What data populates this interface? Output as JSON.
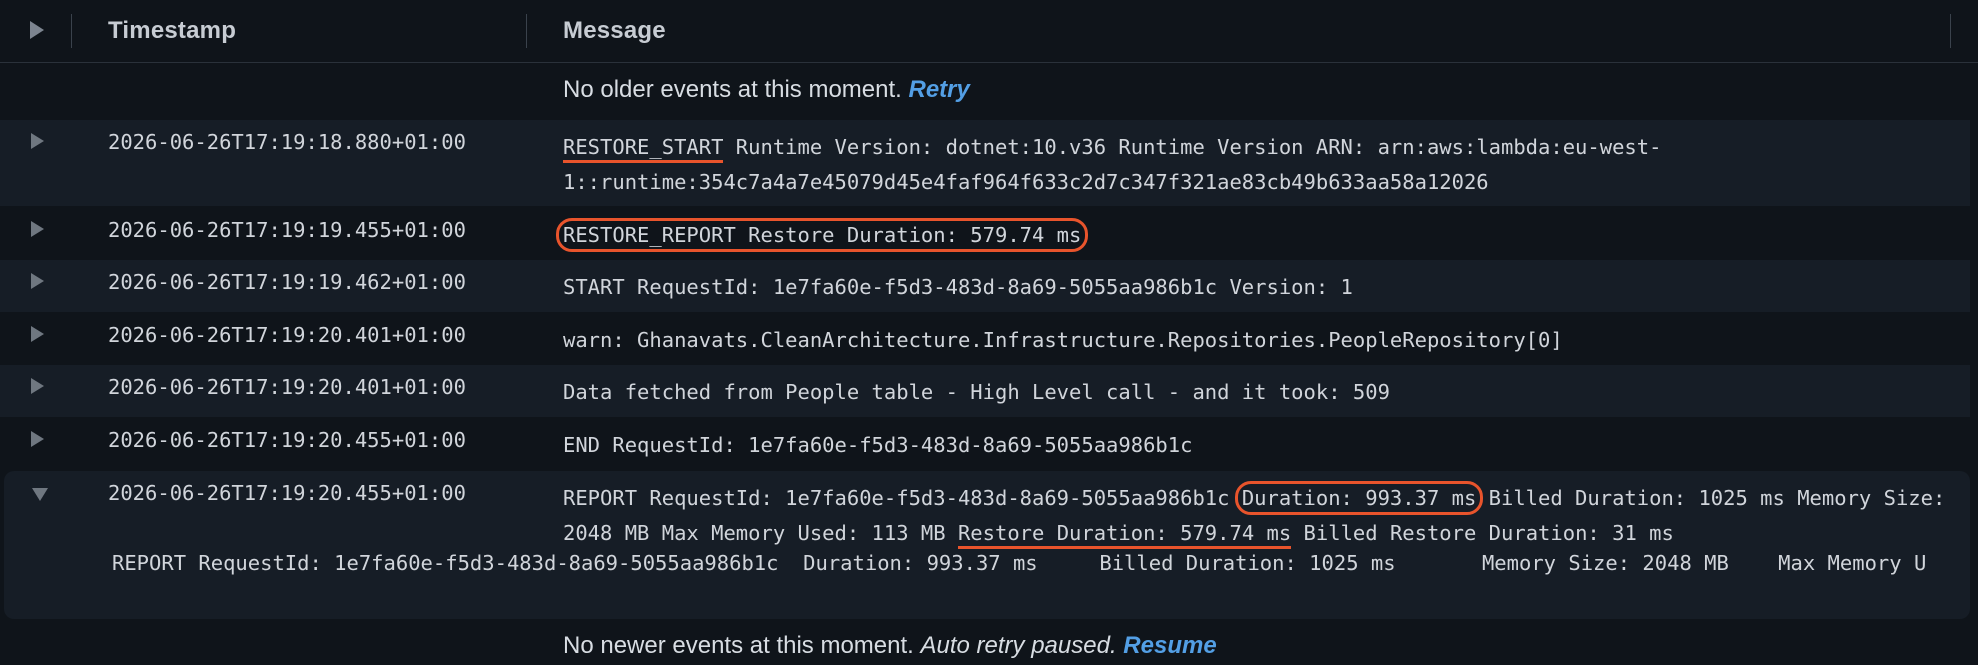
{
  "header": {
    "timestamp_label": "Timestamp",
    "message_label": "Message"
  },
  "top_notice": {
    "text": "No older events at this moment.",
    "link": "Retry"
  },
  "rows": [
    {
      "timestamp": "2026-06-26T17:19:18.880+01:00",
      "msg_a": "RESTORE_START",
      "msg_b": " Runtime Version: dotnet:10.v36 Runtime Version ARN: arn:aws:lambda:eu-west-1::runtime:354c7a4a7e45079d45e4faf964f633c2d7c347f321ae83cb49b633aa58a12026"
    },
    {
      "timestamp": "2026-06-26T17:19:19.455+01:00",
      "msg_a": "RESTORE_REPORT Restore Duration: 579.74 ms"
    },
    {
      "timestamp": "2026-06-26T17:19:19.462+01:00",
      "msg": "START RequestId: 1e7fa60e-f5d3-483d-8a69-5055aa986b1c Version: 1"
    },
    {
      "timestamp": "2026-06-26T17:19:20.401+01:00",
      "msg": "warn: Ghanavats.CleanArchitecture.Infrastructure.Repositories.PeopleRepository[0]"
    },
    {
      "timestamp": "2026-06-26T17:19:20.401+01:00",
      "msg": "Data fetched from People table - High Level call - and it took: 509"
    },
    {
      "timestamp": "2026-06-26T17:19:20.455+01:00",
      "msg": "END RequestId: 1e7fa60e-f5d3-483d-8a69-5055aa986b1c"
    },
    {
      "timestamp": "2026-06-26T17:19:20.455+01:00",
      "msg_a": "REPORT RequestId: 1e7fa60e-f5d3-483d-8a69-5055aa986b1c ",
      "msg_b": "Duration: 993.37 ms",
      "msg_c": " Billed Duration: 1025 ms Memory Size: 2048 MB Max Memory Used: 113 MB ",
      "msg_d": "Restore Duration: 579.74 ms",
      "msg_e": " Billed Restore Duration: 31 ms",
      "detail": "REPORT RequestId: 1e7fa60e-f5d3-483d-8a69-5055aa986b1c  Duration: 993.37 ms     Billed Duration: 1025 ms       Memory Size: 2048 MB    Max Memory U"
    }
  ],
  "bottom_notice": {
    "text": "No newer events at this moment.",
    "italic": "Auto retry paused.",
    "link": "Resume"
  },
  "colors": {
    "background": "#0f141a",
    "row_alt": "#161d26",
    "link": "#539fe5",
    "highlight": "#e8542c"
  }
}
